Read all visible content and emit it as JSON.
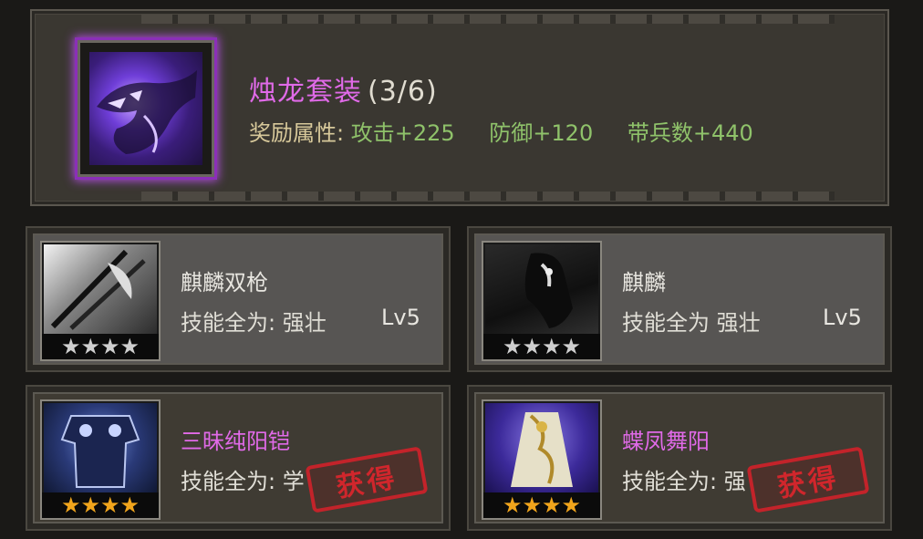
{
  "set": {
    "title": "烛龙套装",
    "count": "(3/6)",
    "bonus_label": "奖励属性:",
    "bonuses": [
      "攻击+225",
      "防御+120",
      "带兵数+440"
    ]
  },
  "items": [
    {
      "name": "麒麟双枪",
      "skill_label": "技能全为:",
      "skill_value": "强壮",
      "level": "Lv5",
      "stars": "★★★★"
    },
    {
      "name": "麒麟",
      "skill_label": "技能全为",
      "skill_value": "强壮",
      "level": "Lv5",
      "stars": "★★★★"
    },
    {
      "name": "三昧纯阳铠",
      "skill_label": "技能全为:",
      "skill_value": "学",
      "stamp": "获得",
      "stars": "★★★★"
    },
    {
      "name": "蝶凤舞阳",
      "skill_label": "技能全为:",
      "skill_value": "强",
      "stamp": "获得",
      "stars": "★★★★"
    }
  ],
  "colors": {
    "name_purple": "#e06ae8",
    "bonus_green": "#8fc26a",
    "star_gold": "#f1a51c",
    "stamp_red": "#c3232a"
  }
}
